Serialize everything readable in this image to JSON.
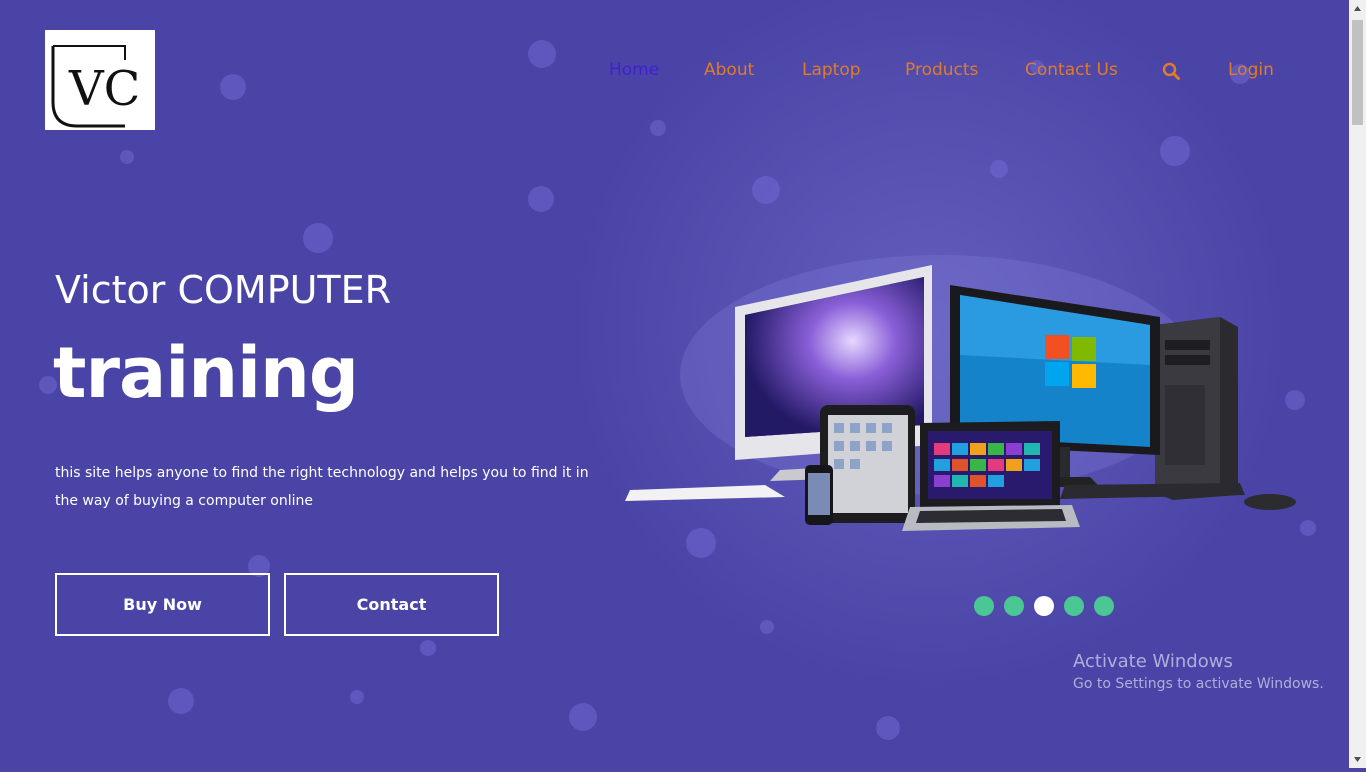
{
  "brand": {
    "logo_text": "VC"
  },
  "nav": {
    "items": [
      "Home",
      "About",
      "Laptop",
      "Products",
      "Contact Us"
    ],
    "active_index": 0,
    "search_icon": "search-icon",
    "login": "Login"
  },
  "hero": {
    "title_small": "Victor COMPUTER",
    "title_large": "training",
    "description": "this site helps anyone to find the right technology and helps you to find it in the way of buying a computer online",
    "buttons": {
      "buy": "Buy Now",
      "contact": "Contact"
    },
    "image": "computer-devices-image"
  },
  "carousel": {
    "count": 5,
    "active_index": 2
  },
  "watermark": {
    "title": "Activate Windows",
    "subtitle": "Go to Settings to activate Windows."
  },
  "colors": {
    "background": "#4a44a6",
    "nav_link": "#e07b2a",
    "nav_active": "#3f1fd2",
    "dot": "#4bc795",
    "dot_active": "#ffffff"
  }
}
